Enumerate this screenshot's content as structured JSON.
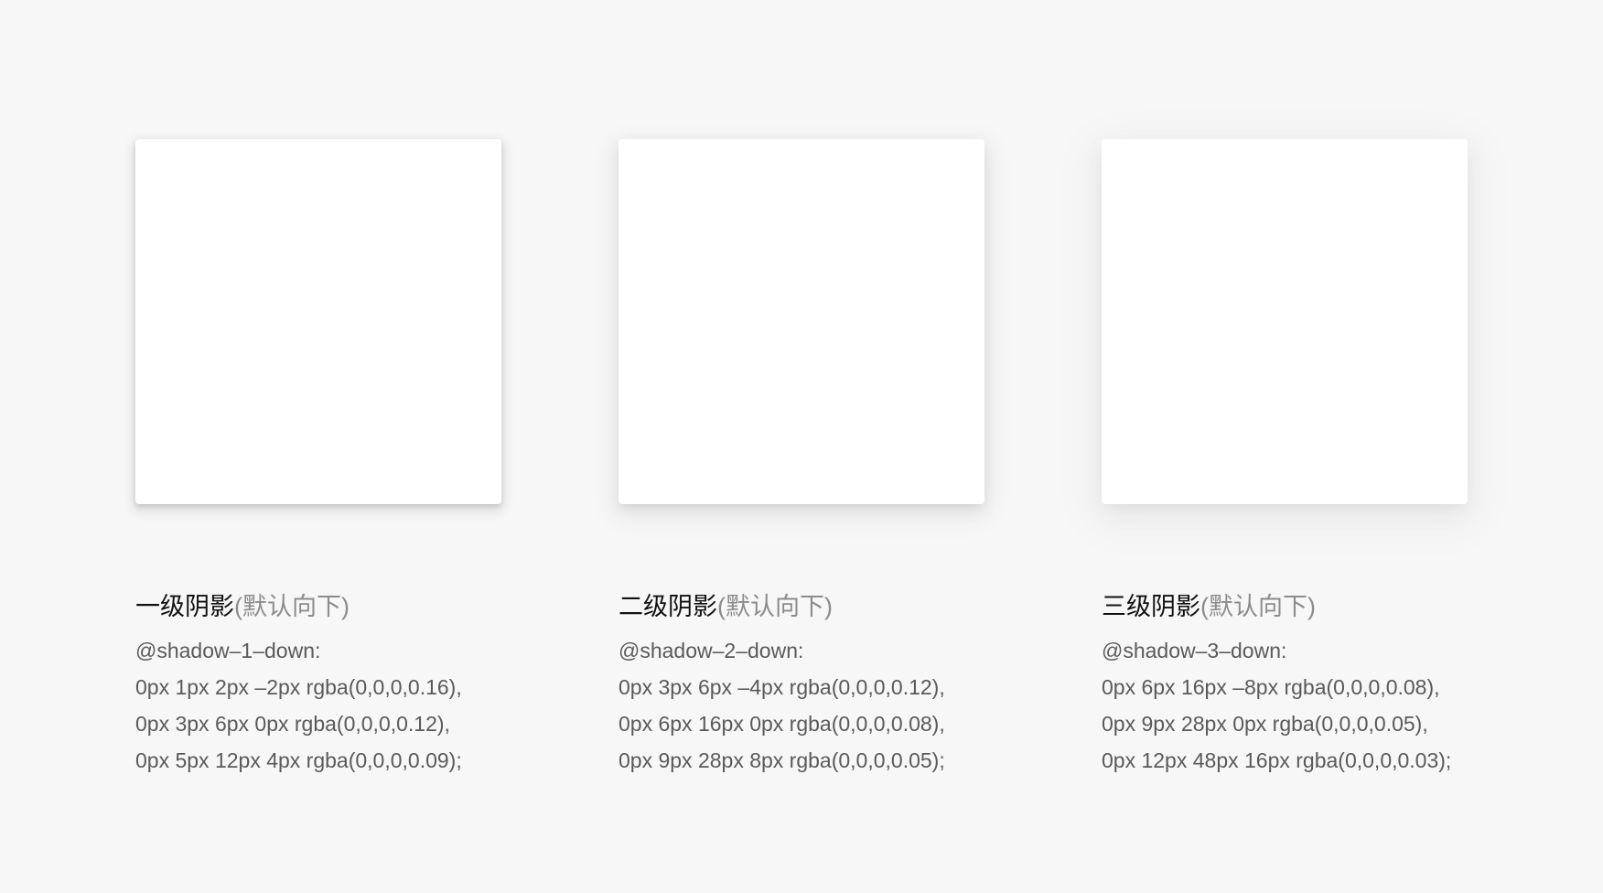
{
  "columns": [
    {
      "title": "一级阴影",
      "note": "(默认向下)",
      "token": "@shadow–1–down:",
      "lines": [
        "0px 1px 2px –2px rgba(0,0,0,0.16),",
        "0px 3px 6px 0px rgba(0,0,0,0.12),",
        "0px 5px 12px 4px rgba(0,0,0,0.09);"
      ]
    },
    {
      "title": "二级阴影",
      "note": "(默认向下)",
      "token": "@shadow–2–down:",
      "lines": [
        "0px 3px 6px –4px rgba(0,0,0,0.12),",
        "0px 6px 16px 0px rgba(0,0,0,0.08),",
        "0px 9px 28px 8px rgba(0,0,0,0.05);"
      ]
    },
    {
      "title": "三级阴影",
      "note": "(默认向下)",
      "token": "@shadow–3–down:",
      "lines": [
        "0px 6px 16px –8px rgba(0,0,0,0.08),",
        "0px 9px 28px 0px rgba(0,0,0,0.05),",
        "0px 12px 48px 16px rgba(0,0,0,0.03);"
      ]
    }
  ],
  "colors": {
    "background": "#f7f7f7",
    "card": "#ffffff",
    "title": "#111111",
    "note": "#8c8c8c",
    "code": "#5a5a5a"
  }
}
